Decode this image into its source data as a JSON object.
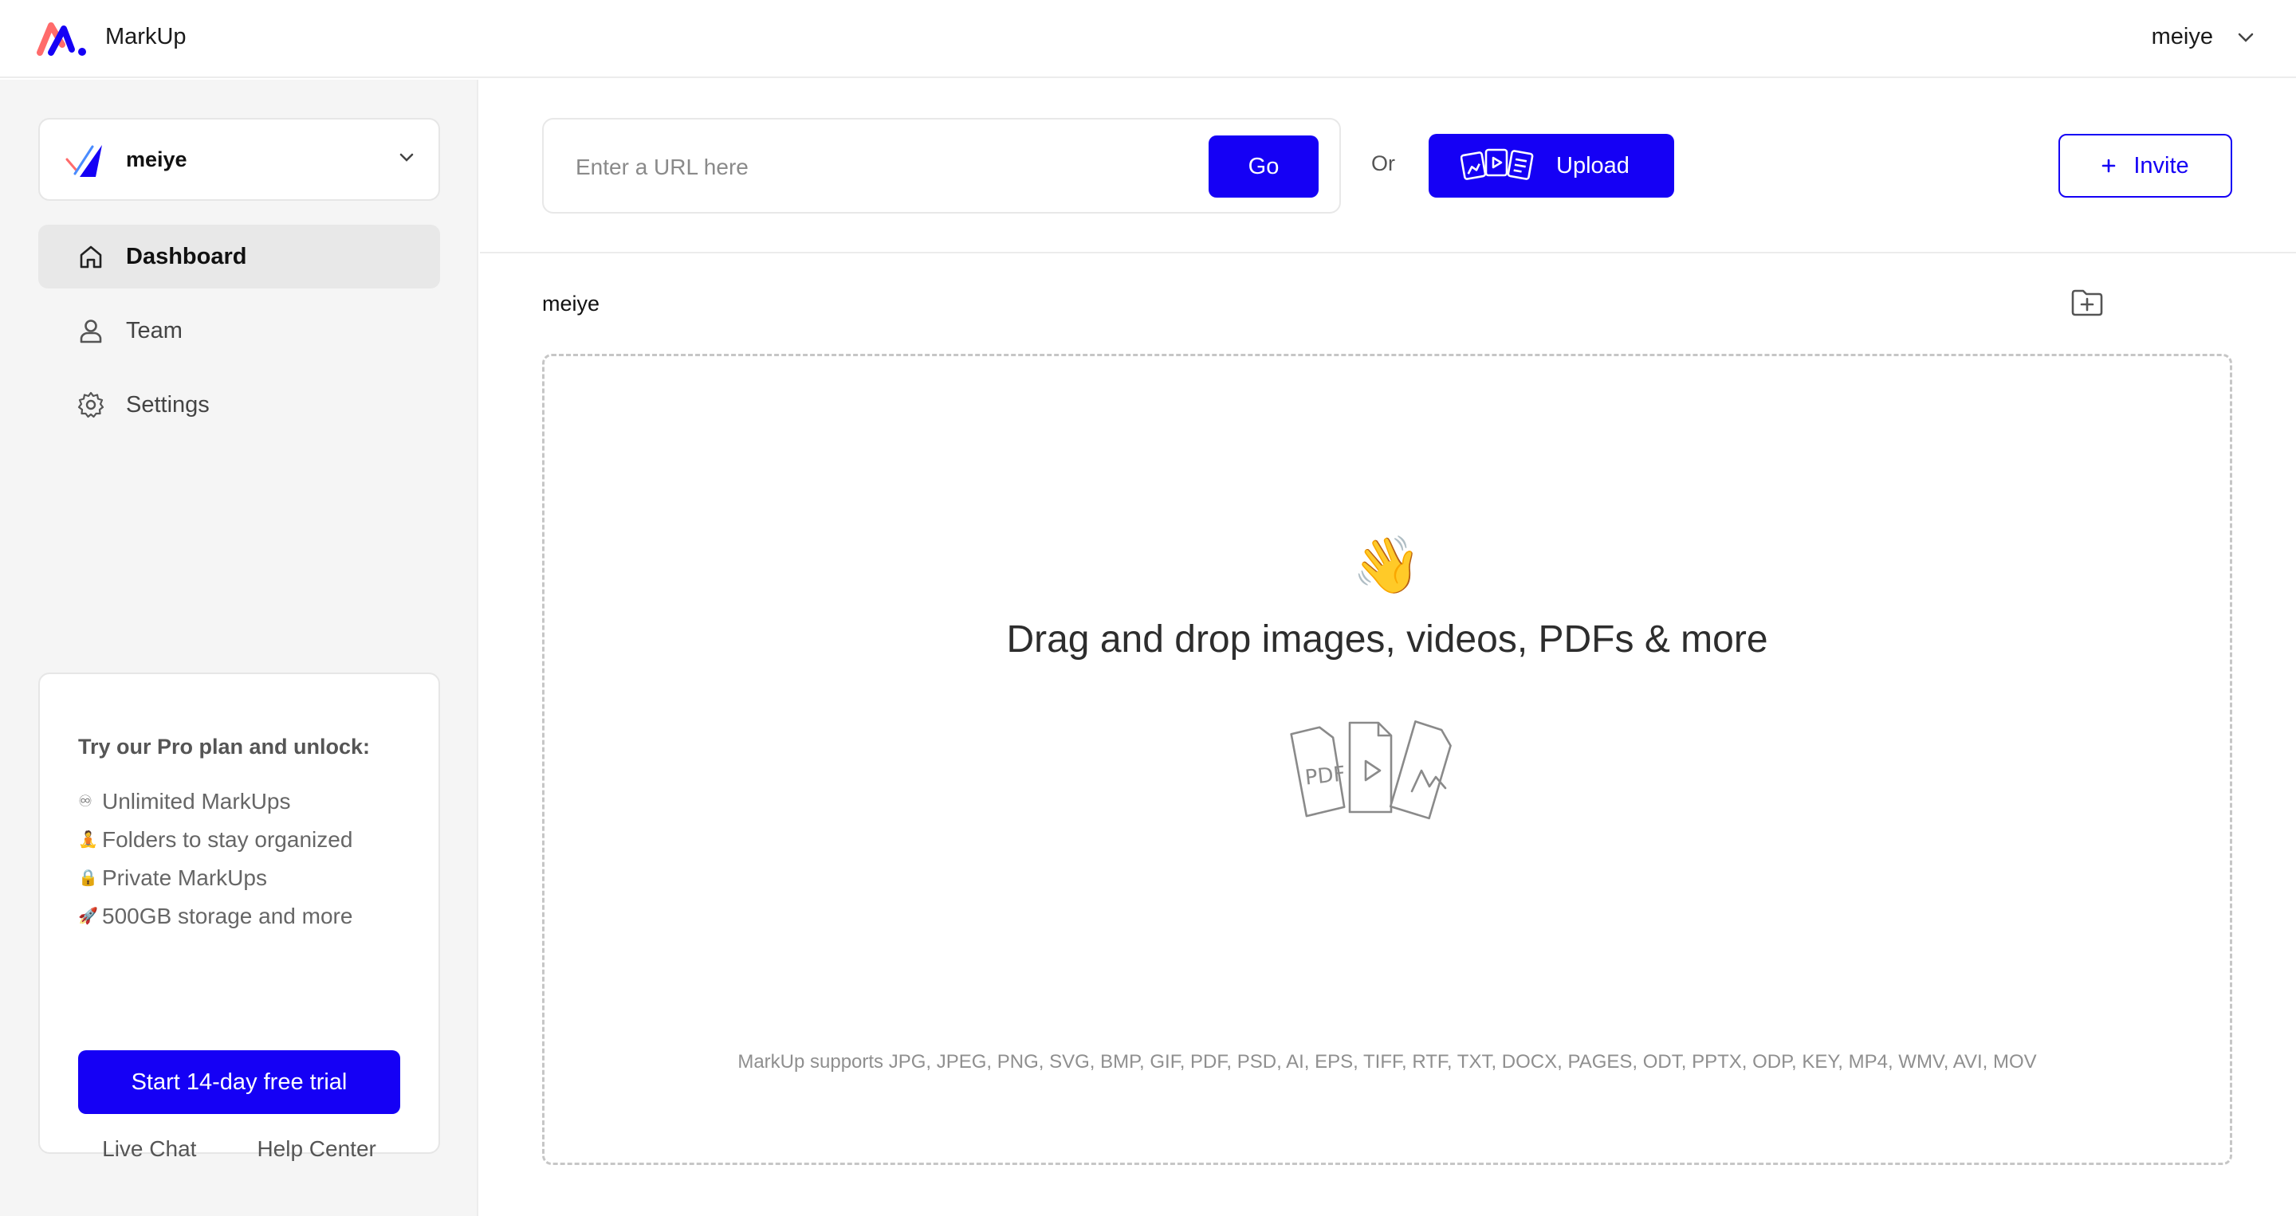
{
  "app": {
    "name": "MarkUp",
    "brand_color": "#1500f5",
    "logo_icon": "markup-logo"
  },
  "header": {
    "user_name": "meiye",
    "menu_icon": "chevron-down-icon"
  },
  "sidebar": {
    "workspace": {
      "name": "meiye",
      "logo_icon": "workspace-logo"
    },
    "nav": [
      {
        "label": "Dashboard",
        "icon": "home-icon",
        "active": true
      },
      {
        "label": "Team",
        "icon": "user-icon",
        "active": false
      },
      {
        "label": "Settings",
        "icon": "gear-icon",
        "active": false
      }
    ],
    "promo": {
      "title": "Try our Pro plan and unlock:",
      "features": [
        {
          "emoji": "♾",
          "text": "Unlimited MarkUps"
        },
        {
          "emoji": "🧘",
          "text": "Folders to stay organized"
        },
        {
          "emoji": "🔒",
          "text": "Private MarkUps"
        },
        {
          "emoji": "🚀",
          "text": "500GB storage and more"
        }
      ],
      "cta": "Start 14-day free trial"
    },
    "footer": {
      "live_chat": "Live Chat",
      "help_center": "Help Center"
    }
  },
  "toolbar": {
    "url_placeholder": "Enter a URL here",
    "go_label": "Go",
    "or_label": "Or",
    "upload_label": "Upload",
    "invite_label": "Invite"
  },
  "content": {
    "folder_name": "meiye",
    "dropzone": {
      "emoji": "👋",
      "title": "Drag and drop images, videos, PDFs & more",
      "file_icon_label": "PDF",
      "supported": "MarkUp supports JPG, JPEG, PNG, SVG, BMP, GIF, PDF, PSD, AI, EPS, TIFF, RTF, TXT, DOCX, PAGES, ODT, PPTX, ODP, KEY, MP4, WMV, AVI, MOV"
    }
  }
}
